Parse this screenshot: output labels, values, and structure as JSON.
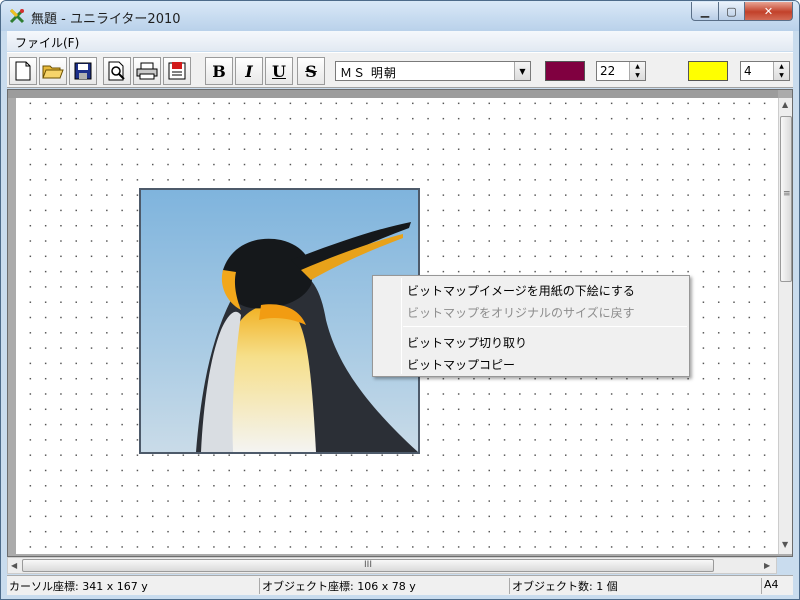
{
  "window": {
    "title": "無題 - ユニライター2010",
    "min_glyph": "▁",
    "max_glyph": "▢",
    "close_glyph": "✕"
  },
  "menu": {
    "file": "ファイル(F)"
  },
  "toolbar": {
    "icons": [
      "new-document-icon",
      "open-folder-icon",
      "save-disk-icon",
      "print-preview-icon",
      "print-icon",
      "properties-icon"
    ],
    "bold": "B",
    "italic": "I",
    "underline": "U",
    "strike": "S",
    "font_name": "ＭＳ 明朝",
    "text_color": "#800040",
    "font_size": "22",
    "fill_color": "#ffff00",
    "line_width": "4"
  },
  "context_menu": {
    "items": [
      {
        "label": "ビットマップイメージを用紙の下絵にする",
        "enabled": true
      },
      {
        "label": "ビットマップをオリジナルのサイズに戻す",
        "enabled": false
      },
      {
        "label": "ビットマップ切り取り",
        "enabled": true
      },
      {
        "label": "ビットマップコピー",
        "enabled": true
      }
    ]
  },
  "status": {
    "cursor": "カーソル座標: 341 x    167 y",
    "object_coord": "オブジェクト座標: 106 x    78 y",
    "object_count": "オブジェクト数: 1 個",
    "paper": "A4"
  },
  "scroll": {
    "h_grip": "III",
    "v_grip": "≡"
  }
}
